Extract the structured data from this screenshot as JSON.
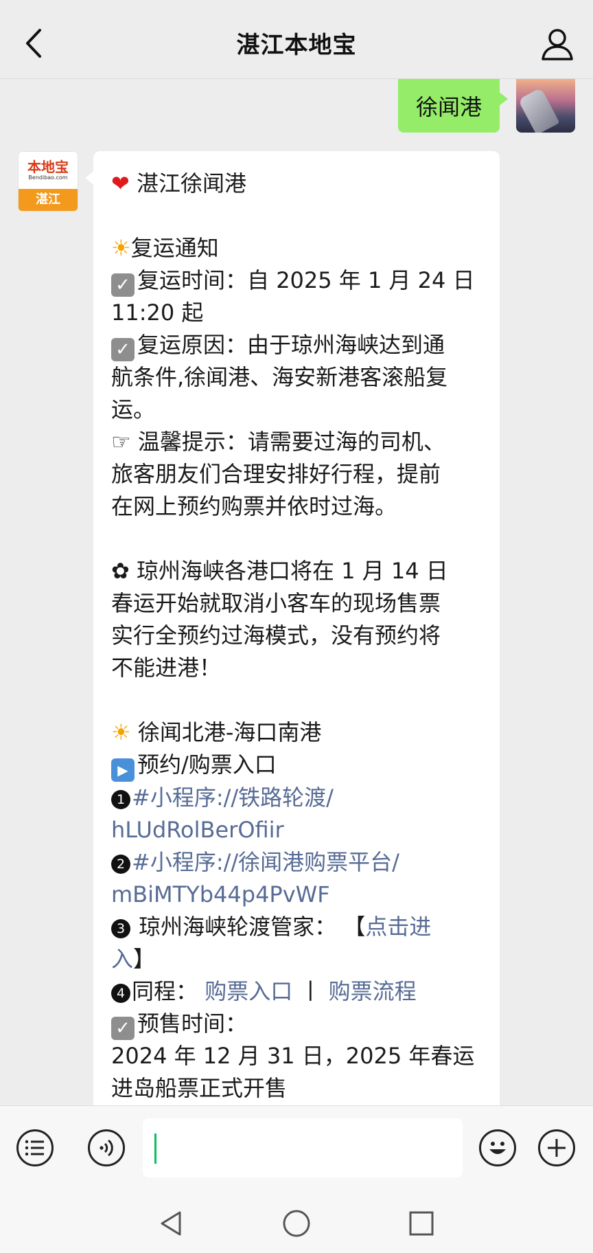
{
  "header": {
    "title": "湛江本地宝"
  },
  "outgoing_message": {
    "text": "徐闻港"
  },
  "bot": {
    "logo_text": "本地宝",
    "logo_url": "Bendibao.com",
    "logo_city": "湛江"
  },
  "message": {
    "title": "湛江徐闻港",
    "notice_title": "复运通知",
    "time_label": "复运时间：",
    "time_value_1": "自 2025 年 1 月 24 日",
    "time_value_2": "11:20 起",
    "reason_1": "复运原因：由于琼州海峡达到通",
    "reason_2": "航条件,徐闻港、海安新港客滚船复",
    "reason_3": "运。",
    "tip_1": "温馨提示：请需要过海的司机、",
    "tip_2": "旅客朋友们合理安排好行程，提前",
    "tip_3": "在网上预约购票并依时过海。",
    "policy_1": "琼州海峡各港口将在 1 月 14 日",
    "policy_2": "春运开始就取消小客车的现场售票",
    "policy_3": "实行全预约过海模式，没有预约将",
    "policy_4": "不能进港！",
    "route": "徐闻北港-海口南港",
    "booking_entry": "预约/购票入口",
    "link1_a": "#小程序://铁路轮渡/",
    "link1_b": "hLUdRolBerOfiir",
    "link2_a": "#小程序://徐闻港购票平台/",
    "link2_b": "mBiMTYb44p4PvWF",
    "item3_label": "琼州海峡轮渡管家：",
    "item3_bracket_open": "【",
    "item3_link_a": "点击进",
    "item3_link_b": "入",
    "item3_bracket_close": "】",
    "item4_label": "同程：",
    "item4_link1": "购票入口",
    "item4_sep": "丨",
    "item4_link2": "购票流程",
    "presale_label": "预售时间：",
    "presale_1": "2024 年 12 月 31 日，2025 年春运",
    "presale_2": "进岛船票正式开售",
    "num1": "1",
    "num2": "2",
    "num3": "3",
    "num4": "4"
  },
  "input": {
    "value": "",
    "placeholder": ""
  },
  "icons": {
    "back": "chevron-left-icon",
    "user": "user-icon",
    "list": "list-icon",
    "voice": "voice-icon",
    "emoji": "emoji-icon",
    "plus": "plus-icon",
    "nav_back": "triangle-back-icon",
    "nav_home": "circle-home-icon",
    "nav_recent": "square-recent-icon"
  },
  "colors": {
    "outgoing_bubble": "#95ec69",
    "link": "#576b95",
    "cursor": "#07c160"
  }
}
